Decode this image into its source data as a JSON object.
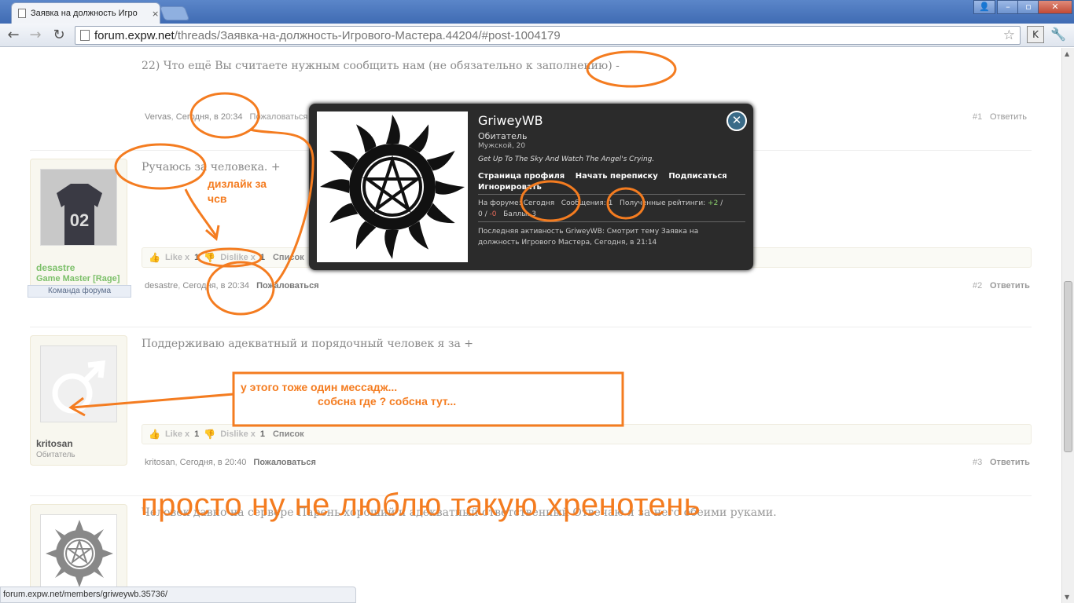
{
  "browser": {
    "tab_title": "Заявка на должность Игро",
    "tab_close": "×",
    "url_host": "forum.expw.net",
    "url_path": "/threads/Заявка-на-должность-Игрового-Мастера.44204/#post-1004179",
    "back_glyph": "←",
    "forward_glyph": "→",
    "reload_glyph": "↻",
    "star_glyph": "☆",
    "ext_label": "K",
    "wrench_glyph": "🔧",
    "user_glyph": "👤",
    "min_glyph": "–",
    "max_glyph": "▫",
    "close_glyph": "✕",
    "status_url": "forum.expw.net/members/griweywb.35736/"
  },
  "posts": [
    {
      "question": "22) Что ещё Вы считаете нужным сообщить нам (не обязательно к заполнению) -",
      "author": "Vervas",
      "time": "Сегодня, в 20:34",
      "report": "Пожаловаться",
      "num": "#1",
      "reply": "Ответить"
    },
    {
      "text": "Ручаюсь за человека. +",
      "author": "desastre",
      "user_title": "Game Master [Rage]",
      "badge": "Команда форума",
      "like": "Like x",
      "like_count": "1",
      "dislike": "Dislike x",
      "dislike_count": "1",
      "list": "Список",
      "time": "Сегодня, в 20:34",
      "report": "Пожаловаться",
      "num": "#2",
      "reply": "Ответить",
      "avatar_text": "02"
    },
    {
      "text": "Поддерживаю адекватный и порядочный человек я за +",
      "author": "kritosan",
      "user_title": "Обитатель",
      "like": "Like x",
      "like_count": "1",
      "dislike": "Dislike x",
      "dislike_count": "1",
      "list": "Список",
      "time": "Сегодня, в 20:40",
      "report": "Пожаловаться",
      "num": "#3",
      "reply": "Ответить"
    },
    {
      "text": "Человек давно на сервере Парень хороший и адекватный ответственный Отвечаю я за него обеими руками."
    }
  ],
  "popup": {
    "name": "GriweyWB",
    "rank": "Обитатель",
    "gender_age": "Мужской, 20",
    "status": "Get Up To The Sky And Watch The Angel's Crying.",
    "link_profile": "Страница профиля",
    "link_conv": "Начать переписку",
    "link_follow": "Подписаться",
    "link_ignore": "Игнорировать",
    "on_forum_label": "На форуме:",
    "on_forum_value": "Сегодня",
    "messages_label": "Сообщения:",
    "messages_value": "1",
    "ratings_label": "Полученные рейтинги:",
    "ratings_pos": "+2",
    "ratings_neutral": "0",
    "ratings_neg": "-0",
    "points_label": "Баллы:",
    "points_value": "3",
    "activity": "Последняя активность GriweyWB: Смотрит тему Заявка на должность Игрового Мастера, Сегодня, в 21:14",
    "close_glyph": "✕"
  },
  "annotations": {
    "csv": "дизлайк за\nчсв",
    "box_line1": "у этого тоже один мессадж...",
    "box_line2": "собсна где ? собсна тут...",
    "big": "просто ну не люблю такую хренотень",
    "color": "#f47c20"
  }
}
